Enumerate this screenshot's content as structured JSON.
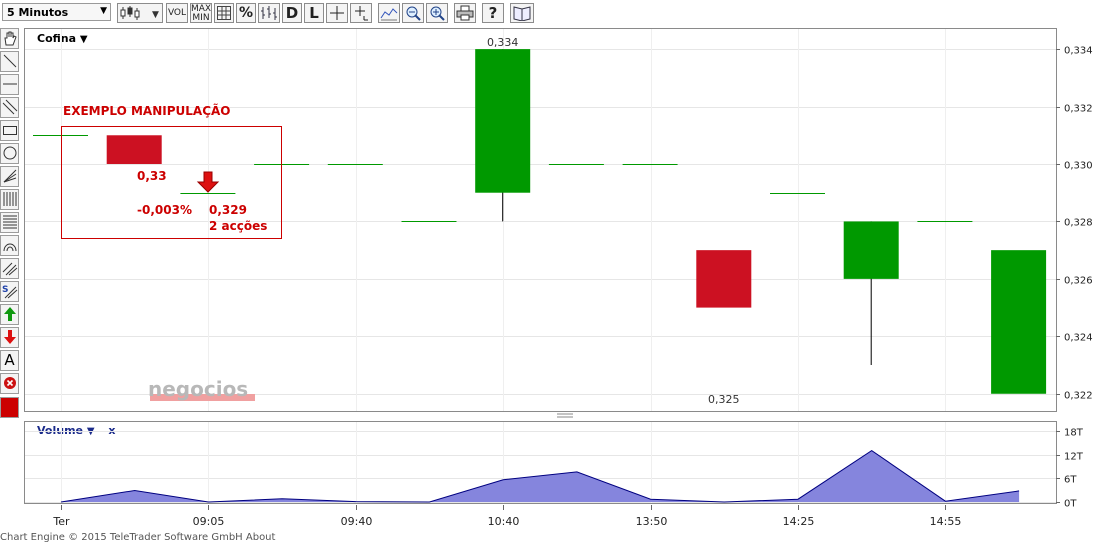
{
  "toolbar": {
    "timeframe": "5 Minutos",
    "vol_label": "VOL",
    "maxmin_top": "MAX",
    "maxmin_bottom": "MIN",
    "percent_label": "%",
    "daily_label": "D",
    "log_label": "L",
    "icons": [
      "candlestick-icon",
      "grid-icon",
      "ohlc-icon",
      "crosshair-icon",
      "cursor-icon",
      "line-chart-icon",
      "zoom-fit-icon",
      "zoom-out-icon",
      "zoom-in-icon",
      "print-icon",
      "help-icon",
      "book-icon"
    ]
  },
  "sidebar": {
    "icons": [
      "hand-icon",
      "diagonal-line-icon",
      "horizontal-line-icon",
      "parallel-lines-icon",
      "rectangle-icon",
      "circle-icon",
      "fan-icon",
      "fibonacci-icon",
      "retracement-icon",
      "arc-icon",
      "channel-icon",
      "speed-lines-icon",
      "arrow-up-icon",
      "arrow-down-icon",
      "text-icon",
      "delete-icon",
      "color-icon"
    ],
    "text_tool": "A",
    "channel_tool": "S",
    "color": "#cc0000"
  },
  "chart_data": [
    {
      "type": "candlestick",
      "symbol": "Cofina",
      "x_labels": [
        "Ter",
        "09:05",
        "09:40",
        "10:40",
        "13:50",
        "14:25",
        "14:55"
      ],
      "candles": [
        {
          "o": 0.331,
          "h": 0.331,
          "l": 0.331,
          "c": 0.331
        },
        {
          "o": 0.331,
          "h": 0.331,
          "l": 0.33,
          "c": 0.33
        },
        {
          "o": 0.329,
          "h": 0.329,
          "l": 0.329,
          "c": 0.329
        },
        {
          "o": 0.33,
          "h": 0.33,
          "l": 0.33,
          "c": 0.33
        },
        {
          "o": 0.33,
          "h": 0.33,
          "l": 0.33,
          "c": 0.33
        },
        {
          "o": 0.328,
          "h": 0.328,
          "l": 0.328,
          "c": 0.328
        },
        {
          "o": 0.329,
          "h": 0.334,
          "l": 0.328,
          "c": 0.334
        },
        {
          "o": 0.33,
          "h": 0.33,
          "l": 0.33,
          "c": 0.33
        },
        {
          "o": 0.33,
          "h": 0.33,
          "l": 0.33,
          "c": 0.33
        },
        {
          "o": 0.327,
          "h": 0.327,
          "l": 0.325,
          "c": 0.325
        },
        {
          "o": 0.329,
          "h": 0.329,
          "l": 0.329,
          "c": 0.329
        },
        {
          "o": 0.326,
          "h": 0.328,
          "l": 0.323,
          "c": 0.328
        },
        {
          "o": 0.328,
          "h": 0.328,
          "l": 0.328,
          "c": 0.328
        },
        {
          "o": 0.322,
          "h": 0.327,
          "l": 0.322,
          "c": 0.327
        }
      ],
      "y_ticks": [
        "0,334",
        "0,332",
        "0,330",
        "0,328",
        "0,326",
        "0,324",
        "0,322"
      ],
      "ylim": [
        0.3214,
        0.3347
      ],
      "high_label": "0,334",
      "low_label": "0,325",
      "up_color": "#009900",
      "down_color": "#cc1122",
      "annotation": {
        "title": "EXEMPLO MANIPULAÇÃO",
        "price_1": "0,33",
        "change": "-0,003%",
        "price_2": "0,329",
        "volume": "2 acções",
        "color": "#cc0000"
      },
      "watermark": "negocios"
    },
    {
      "type": "area",
      "title": "Volume",
      "close_label": "x",
      "values": [
        0,
        2.9,
        0,
        0.8,
        0.1,
        0,
        5.6,
        7.6,
        0.7,
        0,
        0.7,
        13,
        0.2,
        2.8
      ],
      "y_ticks": [
        "18T",
        "12T",
        "6T",
        "0T"
      ],
      "ylim": [
        0,
        18.2
      ],
      "fill_color": "#8585dd",
      "line_color": "#000080"
    }
  ],
  "footer": "Chart Engine © 2015 TeleTrader Software GmbH About"
}
